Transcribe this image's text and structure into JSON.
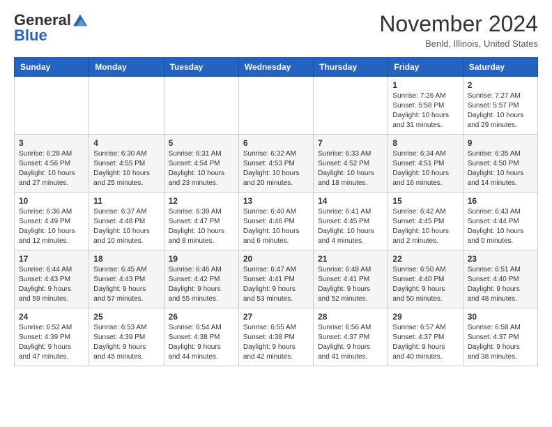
{
  "header": {
    "logo_general": "General",
    "logo_blue": "Blue",
    "month_title": "November 2024",
    "location": "Benld, Illinois, United States"
  },
  "days_of_week": [
    "Sunday",
    "Monday",
    "Tuesday",
    "Wednesday",
    "Thursday",
    "Friday",
    "Saturday"
  ],
  "weeks": [
    [
      {
        "day": "",
        "info": ""
      },
      {
        "day": "",
        "info": ""
      },
      {
        "day": "",
        "info": ""
      },
      {
        "day": "",
        "info": ""
      },
      {
        "day": "",
        "info": ""
      },
      {
        "day": "1",
        "info": "Sunrise: 7:26 AM\nSunset: 5:58 PM\nDaylight: 10 hours\nand 31 minutes."
      },
      {
        "day": "2",
        "info": "Sunrise: 7:27 AM\nSunset: 5:57 PM\nDaylight: 10 hours\nand 29 minutes."
      }
    ],
    [
      {
        "day": "3",
        "info": "Sunrise: 6:28 AM\nSunset: 4:56 PM\nDaylight: 10 hours\nand 27 minutes."
      },
      {
        "day": "4",
        "info": "Sunrise: 6:30 AM\nSunset: 4:55 PM\nDaylight: 10 hours\nand 25 minutes."
      },
      {
        "day": "5",
        "info": "Sunrise: 6:31 AM\nSunset: 4:54 PM\nDaylight: 10 hours\nand 23 minutes."
      },
      {
        "day": "6",
        "info": "Sunrise: 6:32 AM\nSunset: 4:53 PM\nDaylight: 10 hours\nand 20 minutes."
      },
      {
        "day": "7",
        "info": "Sunrise: 6:33 AM\nSunset: 4:52 PM\nDaylight: 10 hours\nand 18 minutes."
      },
      {
        "day": "8",
        "info": "Sunrise: 6:34 AM\nSunset: 4:51 PM\nDaylight: 10 hours\nand 16 minutes."
      },
      {
        "day": "9",
        "info": "Sunrise: 6:35 AM\nSunset: 4:50 PM\nDaylight: 10 hours\nand 14 minutes."
      }
    ],
    [
      {
        "day": "10",
        "info": "Sunrise: 6:36 AM\nSunset: 4:49 PM\nDaylight: 10 hours\nand 12 minutes."
      },
      {
        "day": "11",
        "info": "Sunrise: 6:37 AM\nSunset: 4:48 PM\nDaylight: 10 hours\nand 10 minutes."
      },
      {
        "day": "12",
        "info": "Sunrise: 6:39 AM\nSunset: 4:47 PM\nDaylight: 10 hours\nand 8 minutes."
      },
      {
        "day": "13",
        "info": "Sunrise: 6:40 AM\nSunset: 4:46 PM\nDaylight: 10 hours\nand 6 minutes."
      },
      {
        "day": "14",
        "info": "Sunrise: 6:41 AM\nSunset: 4:45 PM\nDaylight: 10 hours\nand 4 minutes."
      },
      {
        "day": "15",
        "info": "Sunrise: 6:42 AM\nSunset: 4:45 PM\nDaylight: 10 hours\nand 2 minutes."
      },
      {
        "day": "16",
        "info": "Sunrise: 6:43 AM\nSunset: 4:44 PM\nDaylight: 10 hours\nand 0 minutes."
      }
    ],
    [
      {
        "day": "17",
        "info": "Sunrise: 6:44 AM\nSunset: 4:43 PM\nDaylight: 9 hours\nand 59 minutes."
      },
      {
        "day": "18",
        "info": "Sunrise: 6:45 AM\nSunset: 4:43 PM\nDaylight: 9 hours\nand 57 minutes."
      },
      {
        "day": "19",
        "info": "Sunrise: 6:46 AM\nSunset: 4:42 PM\nDaylight: 9 hours\nand 55 minutes."
      },
      {
        "day": "20",
        "info": "Sunrise: 6:47 AM\nSunset: 4:41 PM\nDaylight: 9 hours\nand 53 minutes."
      },
      {
        "day": "21",
        "info": "Sunrise: 6:48 AM\nSunset: 4:41 PM\nDaylight: 9 hours\nand 52 minutes."
      },
      {
        "day": "22",
        "info": "Sunrise: 6:50 AM\nSunset: 4:40 PM\nDaylight: 9 hours\nand 50 minutes."
      },
      {
        "day": "23",
        "info": "Sunrise: 6:51 AM\nSunset: 4:40 PM\nDaylight: 9 hours\nand 48 minutes."
      }
    ],
    [
      {
        "day": "24",
        "info": "Sunrise: 6:52 AM\nSunset: 4:39 PM\nDaylight: 9 hours\nand 47 minutes."
      },
      {
        "day": "25",
        "info": "Sunrise: 6:53 AM\nSunset: 4:39 PM\nDaylight: 9 hours\nand 45 minutes."
      },
      {
        "day": "26",
        "info": "Sunrise: 6:54 AM\nSunset: 4:38 PM\nDaylight: 9 hours\nand 44 minutes."
      },
      {
        "day": "27",
        "info": "Sunrise: 6:55 AM\nSunset: 4:38 PM\nDaylight: 9 hours\nand 42 minutes."
      },
      {
        "day": "28",
        "info": "Sunrise: 6:56 AM\nSunset: 4:37 PM\nDaylight: 9 hours\nand 41 minutes."
      },
      {
        "day": "29",
        "info": "Sunrise: 6:57 AM\nSunset: 4:37 PM\nDaylight: 9 hours\nand 40 minutes."
      },
      {
        "day": "30",
        "info": "Sunrise: 6:58 AM\nSunset: 4:37 PM\nDaylight: 9 hours\nand 38 minutes."
      }
    ]
  ]
}
